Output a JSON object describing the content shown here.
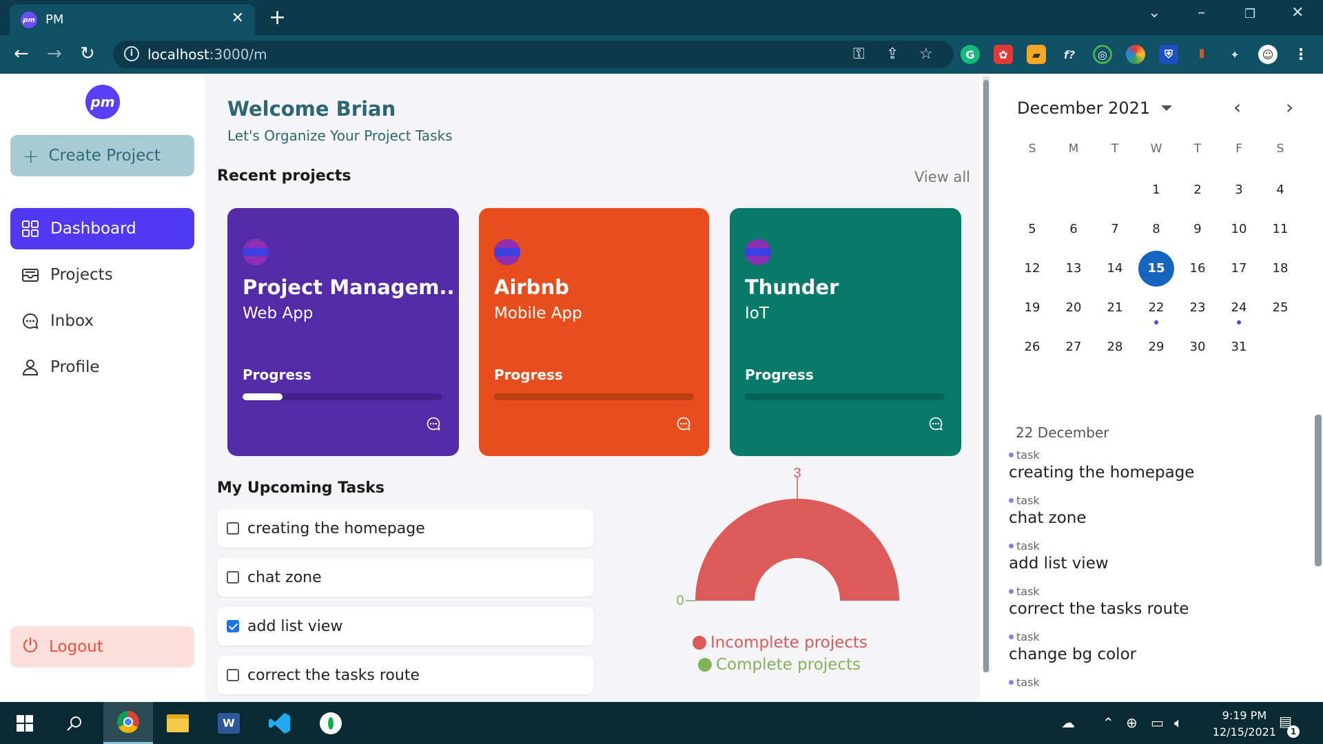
{
  "browser": {
    "tab_title": "PM",
    "favicon_text": "pm",
    "url_host": "localhost",
    "url_path": ":3000/m"
  },
  "sidebar": {
    "logo_text": "pm",
    "create_label": "Create Project",
    "nav": [
      {
        "label": "Dashboard",
        "active": true
      },
      {
        "label": "Projects",
        "active": false
      },
      {
        "label": "Inbox",
        "active": false
      },
      {
        "label": "Profile",
        "active": false
      }
    ],
    "logout_label": "Logout"
  },
  "main": {
    "welcome": "Welcome Brian",
    "subtitle": "Let's Organize Your Project Tasks",
    "recent_title": "Recent projects",
    "view_all": "View all",
    "projects": [
      {
        "name": "Project Managem..",
        "kind": "Web App",
        "progress_label": "Progress",
        "progress": 0.2,
        "color": "#532aa8"
      },
      {
        "name": "Airbnb",
        "kind": "Mobile App",
        "progress_label": "Progress",
        "progress": 0,
        "color": "#e84e1b"
      },
      {
        "name": "Thunder",
        "kind": "IoT",
        "progress_label": "Progress",
        "progress": 0,
        "color": "#077a6a"
      }
    ],
    "tasks_title": "My Upcoming Tasks",
    "tasks": [
      {
        "label": "creating the homepage",
        "checked": false
      },
      {
        "label": "chat zone",
        "checked": false
      },
      {
        "label": "add list view",
        "checked": true
      },
      {
        "label": "correct the tasks route",
        "checked": false
      }
    ]
  },
  "chart_data": {
    "type": "pie",
    "series": [
      {
        "name": "Incomplete projects",
        "value": 3,
        "color": "#dc5a5a"
      },
      {
        "name": "Complete projects",
        "value": 0,
        "color": "#82b35a"
      }
    ],
    "labels": [
      "3",
      "0"
    ]
  },
  "calendar": {
    "month_label": "December 2021",
    "weekdays": [
      "S",
      "M",
      "T",
      "W",
      "T",
      "F",
      "S"
    ],
    "first_weekday": 3,
    "days_in_month": 31,
    "today": 15,
    "event_days": [
      22,
      24
    ]
  },
  "events": {
    "date_label": "22 December",
    "items": [
      {
        "tag": "task",
        "text": "creating the homepage"
      },
      {
        "tag": "task",
        "text": "chat zone"
      },
      {
        "tag": "task",
        "text": "add list view"
      },
      {
        "tag": "task",
        "text": "correct the tasks route"
      },
      {
        "tag": "task",
        "text": "change bg color"
      },
      {
        "tag": "task",
        "text": ""
      }
    ]
  },
  "taskbar": {
    "time": "9:19 PM",
    "date": "12/15/2021",
    "notification_count": "1"
  }
}
